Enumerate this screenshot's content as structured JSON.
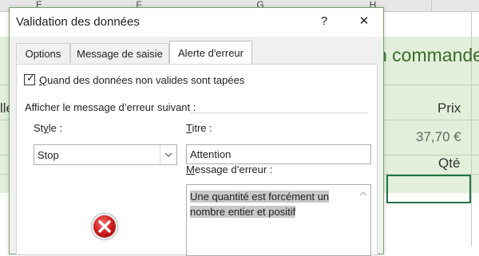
{
  "sheet": {
    "columns": [
      "E",
      "F",
      "G",
      "H"
    ],
    "title_fragment": "n commande",
    "left_fragment": "lle",
    "price_header": "Prix",
    "price_value": "37,70 €",
    "qty_header": "Qté"
  },
  "dialog": {
    "title": "Validation des données",
    "help_label": "?",
    "close_label": "✕",
    "tabs": [
      {
        "label": "Options"
      },
      {
        "label": "Message de saisie"
      },
      {
        "label": "Alerte d'erreur"
      }
    ],
    "active_tab": "Alerte d'erreur",
    "checkbox": {
      "checked": true,
      "label_key": "Q",
      "label_rest": "uand des données non valides sont tapées"
    },
    "section_label": "Afficher le message d’erreur suivant :",
    "style": {
      "label_a": "St",
      "label_key": "y",
      "label_b": "le :",
      "value": "Stop"
    },
    "titre": {
      "label_key": "T",
      "label_rest": "itre :",
      "value": "Attention"
    },
    "message": {
      "label_key": "M",
      "label_rest": "essage d’erreur :",
      "lines": [
        "Une quantité est forcément un",
        "nombre entier et positif"
      ]
    },
    "icon": "stop-error-icon"
  }
}
